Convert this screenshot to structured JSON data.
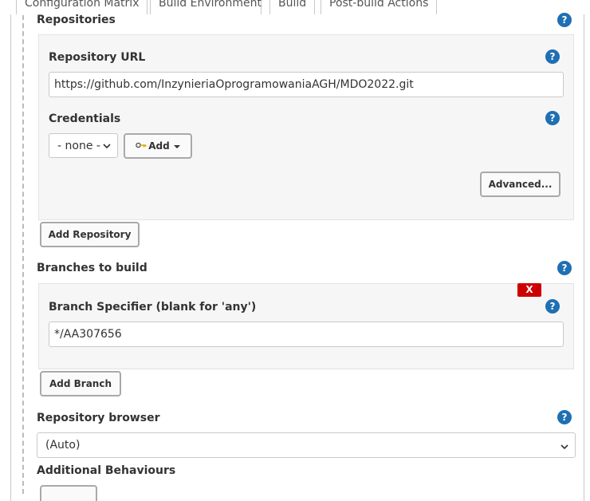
{
  "tabs": [
    {
      "label": "Configuration Matrix",
      "active": false
    },
    {
      "label": "Build Environment",
      "active": true
    },
    {
      "label": "Build",
      "active": false
    },
    {
      "label": "Post-build Actions",
      "active": false
    }
  ],
  "help_glyph": "?",
  "repositories": {
    "title": "Repositories",
    "repository_url_label": "Repository URL",
    "repository_url_value": "https://github.com/InzynieriaOprogramowaniaAGH/MDO2022.git",
    "credentials_label": "Credentials",
    "credentials_selected": "- none -",
    "add_credentials_label": "Add",
    "advanced_label": "Advanced...",
    "add_repository_label": "Add Repository"
  },
  "branches": {
    "title": "Branches to build",
    "delete_label": "X",
    "branch_specifier_label": "Branch Specifier (blank for 'any')",
    "branch_specifier_value": "*/AA307656",
    "add_branch_label": "Add Branch"
  },
  "repository_browser": {
    "label": "Repository browser",
    "selected": "(Auto)"
  },
  "additional_behaviours": {
    "label": "Additional Behaviours"
  },
  "colors": {
    "help_icon": "#1f6fb3",
    "delete_button": "#cc0000",
    "panel_background": "#f6f6f6"
  }
}
